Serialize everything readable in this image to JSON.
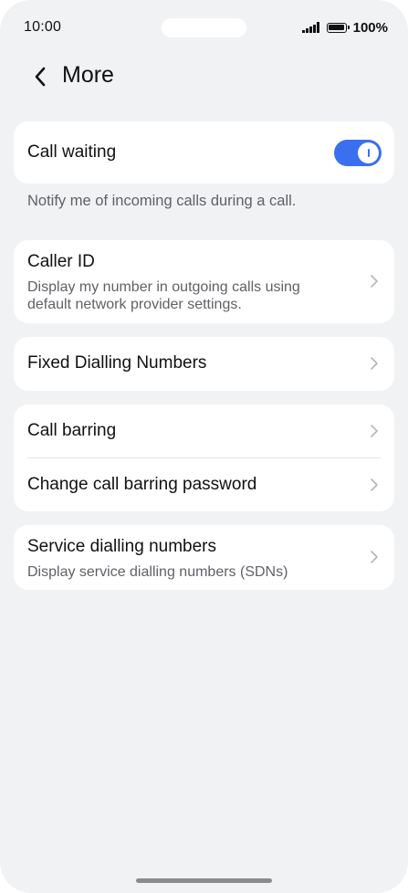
{
  "status_bar": {
    "time": "10:00",
    "battery_text": "100%"
  },
  "header": {
    "title": "More",
    "back_icon": "chevron-left-icon"
  },
  "call_waiting": {
    "label": "Call waiting",
    "enabled": true,
    "note": "Notify me of incoming calls during a call."
  },
  "items": {
    "caller_id": {
      "title": "Caller ID",
      "subtitle_line1": "Display my number in outgoing calls using",
      "subtitle_line2": "default network provider settings."
    },
    "fixed_dialling": {
      "title": "Fixed Dialling Numbers"
    },
    "call_barring": {
      "title": "Call barring"
    },
    "change_barring_password": {
      "title": "Change call barring password"
    },
    "service_dialling": {
      "title": "Service dialling numbers",
      "subtitle": "Display service dialling numbers (SDNs)"
    }
  },
  "colors": {
    "accent": "#3a6ff0",
    "background": "#f1f2f4",
    "card": "#ffffff",
    "secondary_text": "#5f6166",
    "chevron": "#b4b6ba"
  }
}
